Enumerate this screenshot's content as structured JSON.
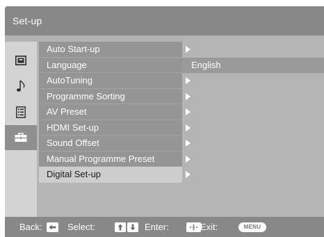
{
  "header": {
    "title": "Set-up"
  },
  "sidebar": {
    "tabs": [
      {
        "icon": "picture-icon",
        "active": false
      },
      {
        "icon": "music-note-icon",
        "active": false
      },
      {
        "icon": "channel-list-icon",
        "active": false
      },
      {
        "icon": "toolbox-icon",
        "active": true
      }
    ]
  },
  "menu": {
    "items": [
      {
        "label": "Auto Start-up",
        "value": ""
      },
      {
        "label": "Language",
        "value": "English"
      },
      {
        "label": "AutoTuning",
        "value": ""
      },
      {
        "label": "Programme Sorting",
        "value": ""
      },
      {
        "label": "AV Preset",
        "value": ""
      },
      {
        "label": "HDMI Set-up",
        "value": ""
      },
      {
        "label": "Sound Offset",
        "value": ""
      },
      {
        "label": "Manual Programme Preset",
        "value": ""
      },
      {
        "label": "Digital Set-up",
        "value": ""
      }
    ],
    "selected_index": 8
  },
  "footer": {
    "back_label": "Back:",
    "select_label": "Select:",
    "enter_label": "Enter:",
    "exit_label": "Exit:",
    "menu_key_label": "MENU"
  }
}
